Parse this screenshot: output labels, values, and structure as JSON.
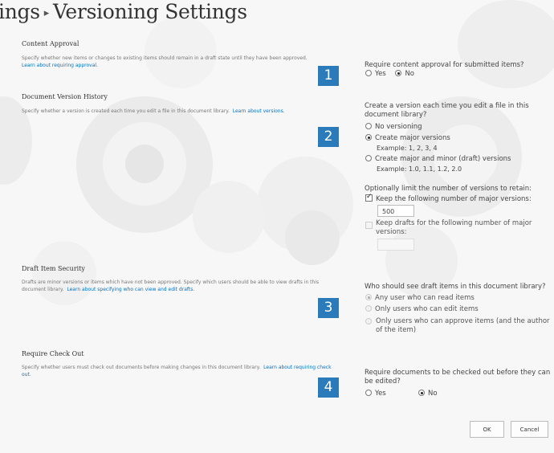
{
  "page": {
    "title_prefix": "ings",
    "title": "Versioning Settings"
  },
  "sections": {
    "content_approval": {
      "heading": "Content Approval",
      "description": "Specify whether new items or changes to existing items should remain in a draft state until they have been approved.",
      "link": "Learn about requiring approval.",
      "badge": "1",
      "question": "Require content approval for submitted items?",
      "options": [
        "Yes",
        "No"
      ],
      "selected": "No"
    },
    "document_version_history": {
      "heading": "Document Version History",
      "description": "Specify whether a version is created each time you edit a file in this document library.",
      "link": "Learn about versions.",
      "badge": "2",
      "question": "Create a version each time you edit a file in this document library?",
      "options": [
        "No versioning",
        "Create major versions",
        "Create major and minor (draft) versions"
      ],
      "selected": "Create major versions",
      "major_example": "Example: 1, 2, 3, 4",
      "minor_example": "Example: 1.0, 1.1, 1.2, 2.0",
      "limit_label": "Optionally limit the number of versions to retain:",
      "keep_major_label": "Keep the following number of major versions:",
      "keep_major_checked": true,
      "keep_major_value": "500",
      "keep_drafts_label": "Keep drafts for the following number of major versions:",
      "keep_drafts_checked": false,
      "keep_drafts_value": ""
    },
    "draft_item_security": {
      "heading": "Draft Item Security",
      "description": "Drafts are minor versions or items which have not been approved. Specify which users should be able to view drafts in this document library.",
      "link": "Learn about specifying who can view and edit drafts.",
      "badge": "3",
      "question": "Who should see draft items in this document library?",
      "options": [
        "Any user who can read items",
        "Only users who can edit items",
        "Only users who can approve items (and the author of the item)"
      ],
      "selected": "Any user who can read items"
    },
    "require_check_out": {
      "heading": "Require Check Out",
      "description": "Specify whether users must check out documents before making changes in this document library.",
      "link": "Learn about requiring check out.",
      "badge": "4",
      "question": "Require documents to be checked out before they can be edited?",
      "options": [
        "Yes",
        "No"
      ],
      "selected": "No"
    }
  },
  "buttons": {
    "ok": "OK",
    "cancel": "Cancel"
  },
  "colors": {
    "badge": "#2b7ab9",
    "link": "#0072c6",
    "background": "#f7f7f7"
  }
}
